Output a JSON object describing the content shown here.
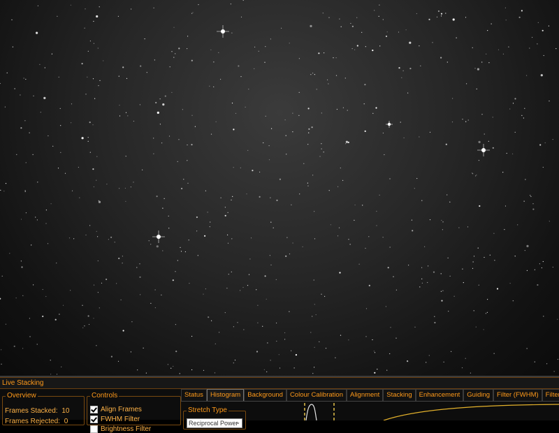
{
  "panel": {
    "title": "Live Stacking",
    "overview": {
      "legend": "Overview",
      "frames_stacked_label": "Frames Stacked:",
      "frames_stacked_value": "10",
      "frames_rejected_label": "Frames Rejected:",
      "frames_rejected_value": "0"
    },
    "controls": {
      "legend": "Controls",
      "items": [
        {
          "label": "Align Frames",
          "checked": true
        },
        {
          "label": "FWHM Filter",
          "checked": true
        },
        {
          "label": "Brightness Filter",
          "checked": false
        }
      ]
    },
    "tabs": [
      {
        "label": "Status",
        "active": false
      },
      {
        "label": "Histogram",
        "active": true
      },
      {
        "label": "Background",
        "active": false
      },
      {
        "label": "Colour Calibration",
        "active": false
      },
      {
        "label": "Alignment",
        "active": false
      },
      {
        "label": "Stacking",
        "active": false
      },
      {
        "label": "Enhancement",
        "active": false
      },
      {
        "label": "Guiding",
        "active": false
      },
      {
        "label": "Filter (FWHM)",
        "active": false
      },
      {
        "label": "Filter (Brightness)",
        "active": false
      }
    ],
    "histogram": {
      "stretch_legend": "Stretch Type",
      "stretch_value": "Reciprocal Power"
    }
  },
  "colors": {
    "accent": "#ff9a1a",
    "text": "#ffb347",
    "histogram_curve": "#e3b12b",
    "background": "#0d0d0d"
  }
}
